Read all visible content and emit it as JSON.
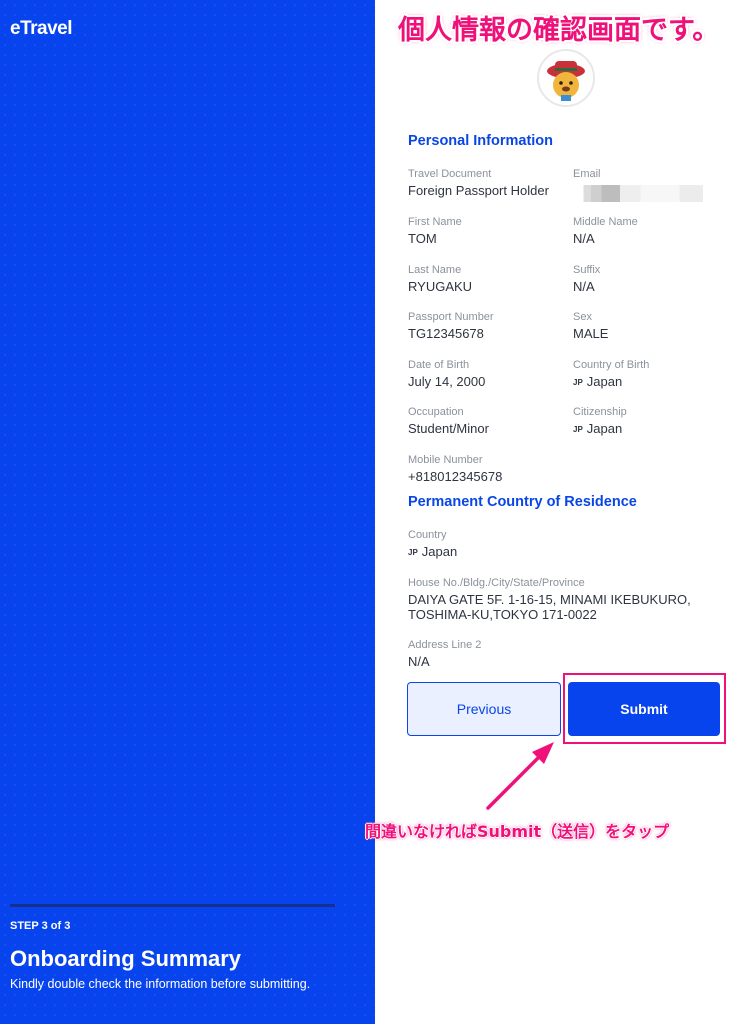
{
  "sidebar": {
    "logo": "eTravel",
    "step_label": "STEP 3 of 3",
    "title": "Onboarding Summary",
    "description": "Kindly double check the information before submitting."
  },
  "annotation": {
    "title": "個人情報の確認画面です。",
    "note": "間違いなければSubmit（送信）をタップ"
  },
  "personal": {
    "heading": "Personal Information",
    "travel_document": {
      "label": "Travel Document",
      "value": "Foreign Passport Holder"
    },
    "email": {
      "label": "Email"
    },
    "first_name": {
      "label": "First Name",
      "value": "TOM"
    },
    "middle_name": {
      "label": "Middle Name",
      "value": "N/A"
    },
    "last_name": {
      "label": "Last Name",
      "value": "RYUGAKU"
    },
    "suffix": {
      "label": "Suffix",
      "value": "N/A"
    },
    "passport_number": {
      "label": "Passport Number",
      "value": "TG12345678"
    },
    "sex": {
      "label": "Sex",
      "value": "MALE"
    },
    "date_of_birth": {
      "label": "Date of Birth",
      "value": "July 14, 2000"
    },
    "country_of_birth": {
      "label": "Country of Birth",
      "flag": "JP",
      "value": "Japan"
    },
    "occupation": {
      "label": "Occupation",
      "value": "Student/Minor"
    },
    "citizenship": {
      "label": "Citizenship",
      "flag": "JP",
      "value": "Japan"
    },
    "mobile_number": {
      "label": "Mobile Number",
      "value": "+818012345678"
    }
  },
  "residence": {
    "heading": "Permanent Country of Residence",
    "country": {
      "label": "Country",
      "flag": "JP",
      "value": "Japan"
    },
    "address": {
      "label": "House No./Bldg./City/State/Province",
      "value": "DAIYA GATE 5F. 1-16-15, MINAMI IKEBUKURO, TOSHIMA-KU,TOKYO 171-0022"
    },
    "address_line_2": {
      "label": "Address Line 2",
      "value": "N/A"
    }
  },
  "buttons": {
    "previous": "Previous",
    "submit": "Submit"
  },
  "colors": {
    "brand_blue": "#0844ee",
    "annotation_pink": "#f0107a"
  }
}
